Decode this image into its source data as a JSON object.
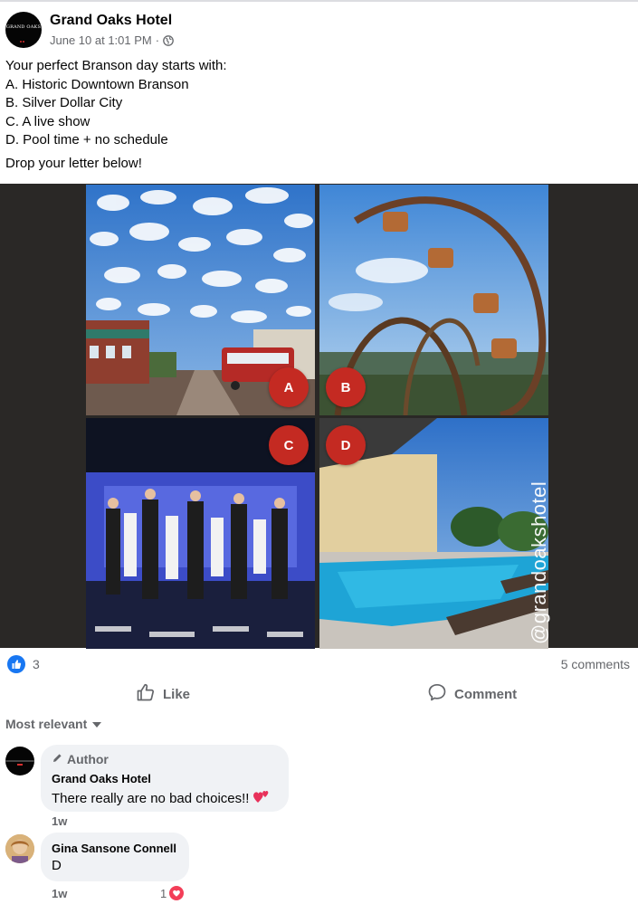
{
  "post": {
    "page_name": "Grand Oaks Hotel",
    "avatar_text": "GRAND OAKS",
    "time": "June 10 at 1:01 PM",
    "separator": "·",
    "privacy_icon": "globe-icon",
    "text_lines": [
      "Your perfect Branson day starts with:",
      "A. Historic Downtown Branson",
      "B. Silver Dollar City",
      "C. A live show",
      "D. Pool time + no schedule"
    ],
    "cta": "Drop your letter below!"
  },
  "media": {
    "badges": [
      "A",
      "B",
      "C",
      "D"
    ],
    "watermark": "@grandoakshotel",
    "badge_color": "#c42a22",
    "background_color": "#2a2826"
  },
  "stats": {
    "reaction_icon": "like-icon",
    "reaction_count": "3",
    "comments": "5 comments"
  },
  "actions": {
    "like_label": "Like",
    "comment_label": "Comment"
  },
  "sort": {
    "label": "Most relevant"
  },
  "comments": [
    {
      "author_tag": "Author",
      "name": "Grand Oaks Hotel",
      "text": "There really are no bad choices!!",
      "emoji": "two-hearts-icon",
      "time": "1w"
    },
    {
      "name": "Gina Sansone Connell",
      "text": "D",
      "time": "1w",
      "reaction_count": "1",
      "reaction_icon": "heart-icon"
    }
  ],
  "colors": {
    "accent": "#1877f2",
    "secondary_text": "#65676b",
    "bubble": "#f0f2f5",
    "heart": "#f33e58"
  }
}
